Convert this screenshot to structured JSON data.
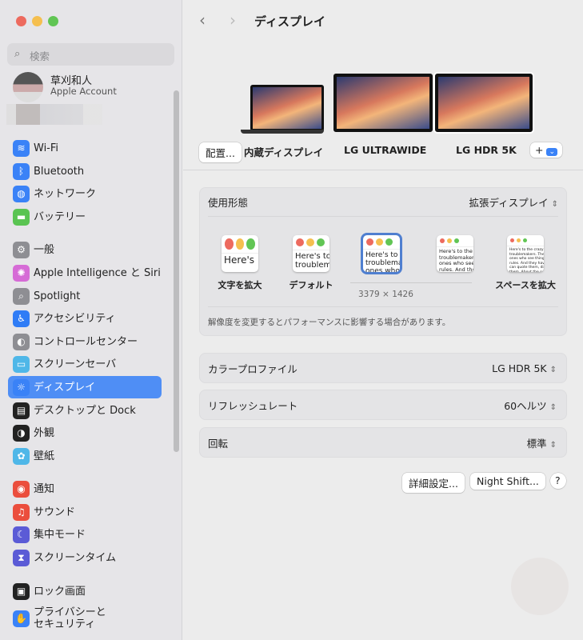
{
  "window": {
    "traffic": [
      "#ed6a5e",
      "#f5bf4f",
      "#61c554"
    ]
  },
  "sidebar": {
    "search_placeholder": "検索",
    "account": {
      "name": "草刈和人",
      "sub": "Apple Account"
    },
    "items": [
      {
        "label": "Wi-Fi",
        "icon": "wifi-icon",
        "glyph": "≋",
        "color": "#3a82f7"
      },
      {
        "label": "Bluetooth",
        "icon": "bluetooth-icon",
        "glyph": "ᛒ",
        "color": "#3a82f7"
      },
      {
        "label": "ネットワーク",
        "icon": "globe-icon",
        "glyph": "◍",
        "color": "#3a82f7"
      },
      {
        "label": "バッテリー",
        "icon": "battery-icon",
        "glyph": "▬",
        "color": "#5ac452"
      },
      {
        "label": "一般",
        "icon": "gear-icon",
        "glyph": "⚙",
        "color": "#8e8e93"
      },
      {
        "label": "Apple Intelligence と Siri",
        "icon": "siri-icon",
        "glyph": "✺",
        "color": "#d66bd6"
      },
      {
        "label": "Spotlight",
        "icon": "spotlight-icon",
        "glyph": "⌕",
        "color": "#8e8e93"
      },
      {
        "label": "アクセシビリティ",
        "icon": "accessibility-icon",
        "glyph": "♿",
        "color": "#2f7cf6"
      },
      {
        "label": "コントロールセンター",
        "icon": "control-center-icon",
        "glyph": "◐",
        "color": "#8e8e93"
      },
      {
        "label": "スクリーンセーバ",
        "icon": "screensaver-icon",
        "glyph": "▭",
        "color": "#4fb7e8"
      },
      {
        "label": "ディスプレイ",
        "icon": "display-icon",
        "glyph": "☼",
        "color": "#3a82f7",
        "selected": true
      },
      {
        "label": "デスクトップと Dock",
        "icon": "dock-icon",
        "glyph": "▤",
        "color": "#222"
      },
      {
        "label": "外観",
        "icon": "appearance-icon",
        "glyph": "◑",
        "color": "#222"
      },
      {
        "label": "壁紙",
        "icon": "wallpaper-icon",
        "glyph": "✿",
        "color": "#4fb7e8"
      },
      {
        "label": "通知",
        "icon": "notifications-icon",
        "glyph": "◉",
        "color": "#eb4e3d"
      },
      {
        "label": "サウンド",
        "icon": "sound-icon",
        "glyph": "♫",
        "color": "#eb4e3d"
      },
      {
        "label": "集中モード",
        "icon": "focus-moon-icon",
        "glyph": "☾",
        "color": "#5b5bd6"
      },
      {
        "label": "スクリーンタイム",
        "icon": "hourglass-icon",
        "glyph": "⧗",
        "color": "#5b5bd6"
      },
      {
        "label": "ロック画面",
        "icon": "lock-icon",
        "glyph": "▣",
        "color": "#222"
      },
      {
        "label": "プライバシーと\nセキュリティ",
        "icon": "privacy-hand-icon",
        "glyph": "✋",
        "color": "#3a82f7"
      }
    ]
  },
  "main": {
    "title": "ディスプレイ",
    "arrange_label": "配置...",
    "displays": [
      "内蔵ディスプレイ",
      "LG ULTRAWIDE",
      "LG HDR 5K"
    ],
    "add_label": "+",
    "use_as": {
      "label": "使用形態",
      "value": "拡張ディスプレイ"
    },
    "scaling": [
      {
        "label": "文字を拡大",
        "text": "Here's"
      },
      {
        "label": "デフォルト",
        "text": "Here's to\ntroublem"
      },
      {
        "label": "",
        "text": "Here's to t\ntroublema\nones who"
      },
      {
        "label": "",
        "text": "Here's to the c\ntroublemakers.\nones who see t\nrules. And they"
      },
      {
        "label": "スペースを拡大",
        "text": "Here's to the crazy one\ntroublemakers. The roun\nones who see things diff\nrules. And they have no\ncan quote them, disagre\nthem. About the only th\nBecause they change th"
      }
    ],
    "resolution": "3379 × 1426",
    "note": "解像度を変更するとパフォーマンスに影響する場合があります。",
    "rows": [
      {
        "label": "カラープロファイル",
        "value": "LG HDR 5K"
      },
      {
        "label": "リフレッシュレート",
        "value": "60ヘルツ"
      },
      {
        "label": "回転",
        "value": "標準"
      }
    ],
    "advanced_label": "詳細設定...",
    "night_shift_label": "Night Shift...",
    "help_label": "?"
  }
}
